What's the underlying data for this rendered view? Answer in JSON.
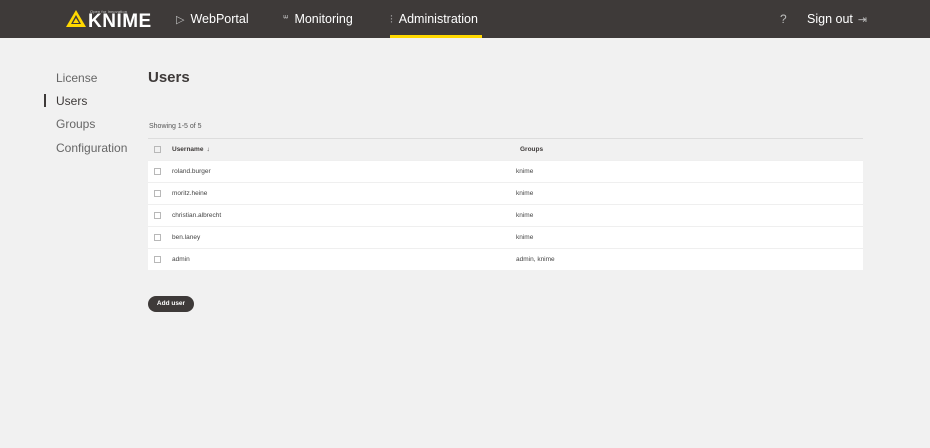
{
  "brand": {
    "small": "Open for Innovation",
    "name": "KNIME"
  },
  "nav": {
    "webportal": {
      "icon": "play-triangle-icon",
      "label": "WebPortal"
    },
    "monitoring": {
      "icon": "monitoring-icon",
      "label": "Monitoring"
    },
    "administration": {
      "icon": "sliders-icon",
      "label": "Administration"
    },
    "help": "?",
    "signout": {
      "label": "Sign out",
      "icon": "sign-out-icon"
    }
  },
  "sidebar": {
    "items": [
      {
        "label": "License"
      },
      {
        "label": "Users"
      },
      {
        "label": "Groups"
      },
      {
        "label": "Configuration"
      }
    ],
    "active": "Users"
  },
  "page": {
    "title": "Users",
    "showing": "Showing 1-5 of 5"
  },
  "table": {
    "headers": {
      "username": "Username",
      "groups": "Groups",
      "sort_icon": "↓"
    },
    "rows": [
      {
        "username": "roland.burger",
        "groups": "knime"
      },
      {
        "username": "moritz.heine",
        "groups": "knime"
      },
      {
        "username": "christian.albrecht",
        "groups": "knime"
      },
      {
        "username": "ben.laney",
        "groups": "knime"
      },
      {
        "username": "admin",
        "groups": "admin, knime"
      }
    ]
  },
  "actions": {
    "add_user": "Add user"
  },
  "colors": {
    "topbar": "#3e3a39",
    "accent": "#ffd800",
    "background": "#f1f1f1"
  }
}
